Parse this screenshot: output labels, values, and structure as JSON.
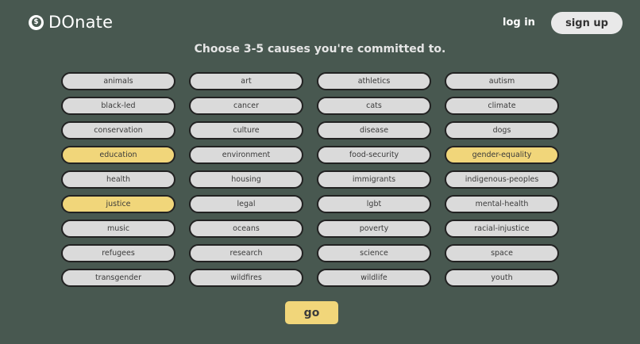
{
  "header": {
    "logo_text": "DOnate",
    "logo_icon_symbol": "$",
    "login_label": "log in",
    "signup_label": "sign up"
  },
  "heading": "Choose 3-5 causes you're committed to.",
  "colors": {
    "background": "#485850",
    "pill": "#dadada",
    "pill_selected": "#f1d67a",
    "go_button": "#f1d67a"
  },
  "causes": [
    {
      "label": "animals",
      "selected": false
    },
    {
      "label": "art",
      "selected": false
    },
    {
      "label": "athletics",
      "selected": false
    },
    {
      "label": "autism",
      "selected": false
    },
    {
      "label": "black-led",
      "selected": false
    },
    {
      "label": "cancer",
      "selected": false
    },
    {
      "label": "cats",
      "selected": false
    },
    {
      "label": "climate",
      "selected": false
    },
    {
      "label": "conservation",
      "selected": false
    },
    {
      "label": "culture",
      "selected": false
    },
    {
      "label": "disease",
      "selected": false
    },
    {
      "label": "dogs",
      "selected": false
    },
    {
      "label": "education",
      "selected": true
    },
    {
      "label": "environment",
      "selected": false
    },
    {
      "label": "food-security",
      "selected": false
    },
    {
      "label": "gender-equality",
      "selected": true
    },
    {
      "label": "health",
      "selected": false
    },
    {
      "label": "housing",
      "selected": false
    },
    {
      "label": "immigrants",
      "selected": false
    },
    {
      "label": "indigenous-peoples",
      "selected": false
    },
    {
      "label": "justice",
      "selected": true
    },
    {
      "label": "legal",
      "selected": false
    },
    {
      "label": "lgbt",
      "selected": false
    },
    {
      "label": "mental-health",
      "selected": false
    },
    {
      "label": "music",
      "selected": false
    },
    {
      "label": "oceans",
      "selected": false
    },
    {
      "label": "poverty",
      "selected": false
    },
    {
      "label": "racial-injustice",
      "selected": false
    },
    {
      "label": "refugees",
      "selected": false
    },
    {
      "label": "research",
      "selected": false
    },
    {
      "label": "science",
      "selected": false
    },
    {
      "label": "space",
      "selected": false
    },
    {
      "label": "transgender",
      "selected": false
    },
    {
      "label": "wildfires",
      "selected": false
    },
    {
      "label": "wildlife",
      "selected": false
    },
    {
      "label": "youth",
      "selected": false
    }
  ],
  "go_label": "go"
}
